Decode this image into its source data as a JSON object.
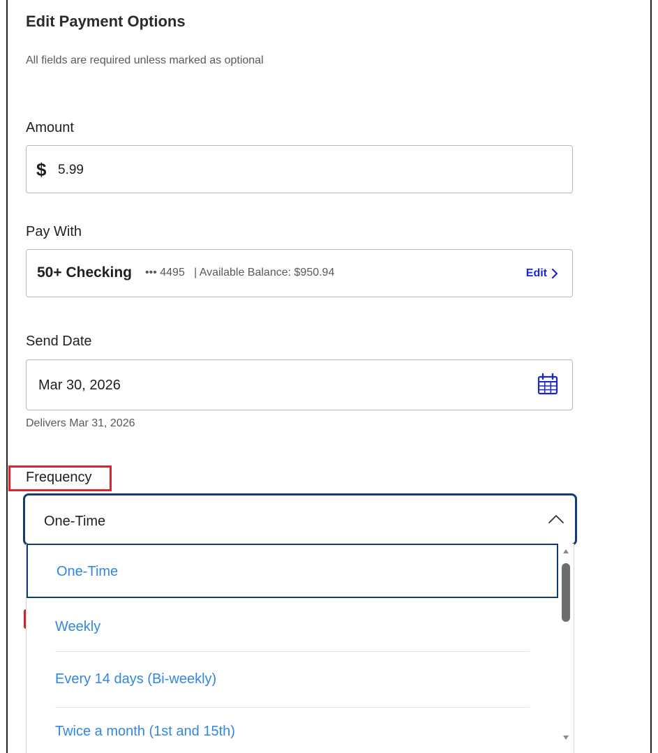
{
  "page": {
    "title": "Edit Payment Options",
    "subtitle": "All fields are required unless marked as optional"
  },
  "amount": {
    "label": "Amount",
    "currency_symbol": "$",
    "value": "5.99"
  },
  "pay_with": {
    "label": "Pay With",
    "account_name": "50+ Checking",
    "account_mask": "••• 4495",
    "balance_text": "| Available Balance: $950.94",
    "edit_label": "Edit"
  },
  "send_date": {
    "label": "Send Date",
    "value": "Mar 30, 2026",
    "delivers_text": "Delivers Mar 31, 2026",
    "icon": "calendar-icon"
  },
  "frequency": {
    "label": "Frequency",
    "value": "One-Time",
    "expanded": true,
    "options": [
      "One-Time",
      "Weekly",
      "Every 14 days (Bi-weekly)",
      "Twice a month (1st and 15th)"
    ],
    "selected_index": 0
  },
  "colors": {
    "link_blue": "#1a26d6",
    "option_blue": "#3187e0",
    "focus_navy": "#0f3b78",
    "highlight_red": "#e0222a"
  }
}
